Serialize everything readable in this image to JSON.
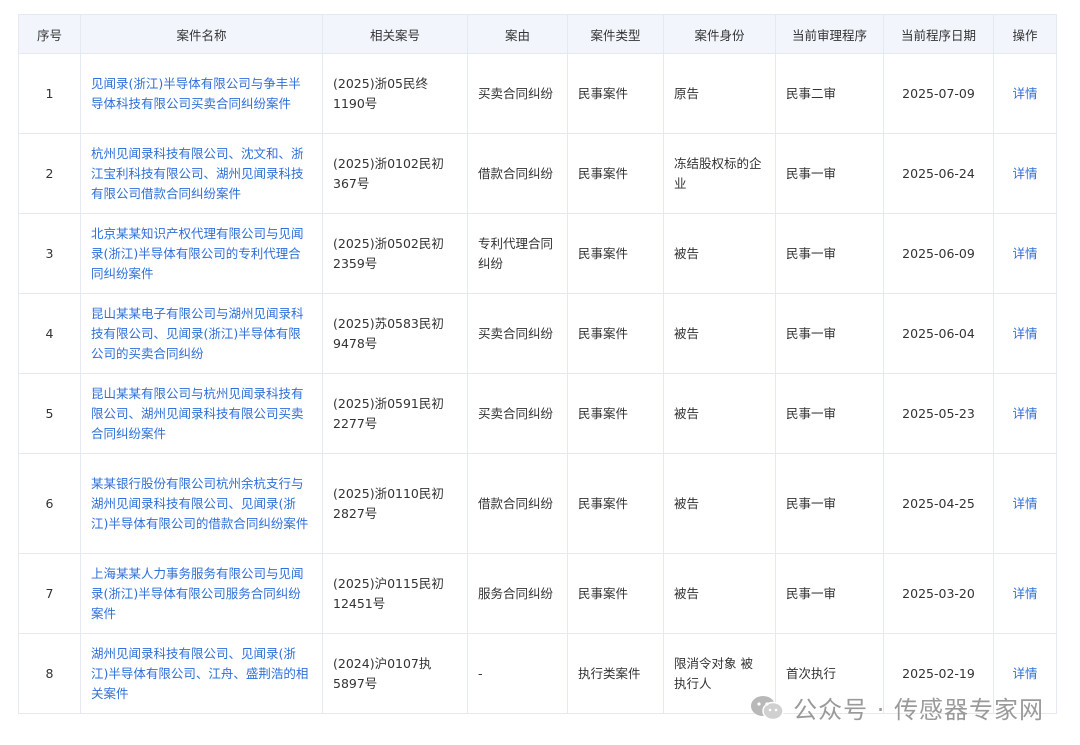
{
  "columns": [
    "序号",
    "案件名称",
    "相关案号",
    "案由",
    "案件类型",
    "案件身份",
    "当前审理程序",
    "当前程序日期",
    "操作"
  ],
  "rows": [
    {
      "no": "1",
      "name": "见闻录(浙江)半导体有限公司与争丰半导体科技有限公司买卖合同纠纷案件",
      "case_no": "(2025)浙05民终1190号",
      "cause": "买卖合同纠纷",
      "type": "民事案件",
      "role": "原告",
      "stage": "民事二审",
      "date": "2025-07-09",
      "op": "详情"
    },
    {
      "no": "2",
      "name": "杭州见闻录科技有限公司、沈文和、浙江宝利科技有限公司、湖州见闻录科技有限公司借款合同纠纷案件",
      "case_no": "(2025)浙0102民初367号",
      "cause": "借款合同纠纷",
      "type": "民事案件",
      "role": "冻结股权标的企业",
      "stage": "民事一审",
      "date": "2025-06-24",
      "op": "详情"
    },
    {
      "no": "3",
      "name": "北京某某知识产权代理有限公司与见闻录(浙江)半导体有限公司的专利代理合同纠纷案件",
      "case_no": "(2025)浙0502民初2359号",
      "cause": "专利代理合同纠纷",
      "type": "民事案件",
      "role": "被告",
      "stage": "民事一审",
      "date": "2025-06-09",
      "op": "详情"
    },
    {
      "no": "4",
      "name": "昆山某某电子有限公司与湖州见闻录科技有限公司、见闻录(浙江)半导体有限公司的买卖合同纠纷",
      "case_no": "(2025)苏0583民初9478号",
      "cause": "买卖合同纠纷",
      "type": "民事案件",
      "role": "被告",
      "stage": "民事一审",
      "date": "2025-06-04",
      "op": "详情"
    },
    {
      "no": "5",
      "name": "昆山某某有限公司与杭州见闻录科技有限公司、湖州见闻录科技有限公司买卖合同纠纷案件",
      "case_no": "(2025)浙0591民初2277号",
      "cause": "买卖合同纠纷",
      "type": "民事案件",
      "role": "被告",
      "stage": "民事一审",
      "date": "2025-05-23",
      "op": "详情"
    },
    {
      "no": "6",
      "name": "某某银行股份有限公司杭州余杭支行与湖州见闻录科技有限公司、见闻录(浙江)半导体有限公司的借款合同纠纷案件",
      "case_no": "(2025)浙0110民初2827号",
      "cause": "借款合同纠纷",
      "type": "民事案件",
      "role": "被告",
      "stage": "民事一审",
      "date": "2025-04-25",
      "op": "详情"
    },
    {
      "no": "7",
      "name": "上海某某人力事务服务有限公司与见闻录(浙江)半导体有限公司服务合同纠纷案件",
      "case_no": "(2025)沪0115民初12451号",
      "cause": "服务合同纠纷",
      "type": "民事案件",
      "role": "被告",
      "stage": "民事一审",
      "date": "2025-03-20",
      "op": "详情"
    },
    {
      "no": "8",
      "name": "湖州见闻录科技有限公司、见闻录(浙江)半导体有限公司、江舟、盛荆浩的相关案件",
      "case_no": "(2024)沪0107执5897号",
      "cause": "-",
      "type": "执行类案件",
      "role": "限消令对象 被执行人",
      "stage": "首次执行",
      "date": "2025-02-19",
      "op": "详情"
    }
  ],
  "watermark": {
    "text": "公众号 · 传感器专家网",
    "icon": "wechat-icon"
  }
}
